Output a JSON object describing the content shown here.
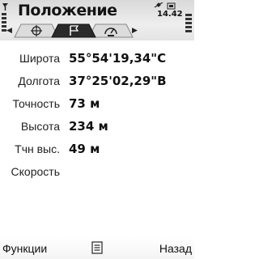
{
  "header": {
    "title": "Положение",
    "clock": "14.42"
  },
  "tabs": [
    {
      "icon": "compass-icon",
      "active": false
    },
    {
      "icon": "flag-icon",
      "active": true
    },
    {
      "icon": "speedometer-icon",
      "active": false
    }
  ],
  "rows": [
    {
      "label": "Широта",
      "value": "55°54'19,34\"С"
    },
    {
      "label": "Долгота",
      "value": "37°25'02,29\"В"
    },
    {
      "label": "Точность",
      "value": "73 м"
    },
    {
      "label": "Высота",
      "value": "234 м"
    },
    {
      "label": "Тчн выс.",
      "value": "49 м"
    },
    {
      "label": "Скорость",
      "value": ""
    }
  ],
  "softkeys": {
    "left": "Функции",
    "right": "Назад"
  }
}
